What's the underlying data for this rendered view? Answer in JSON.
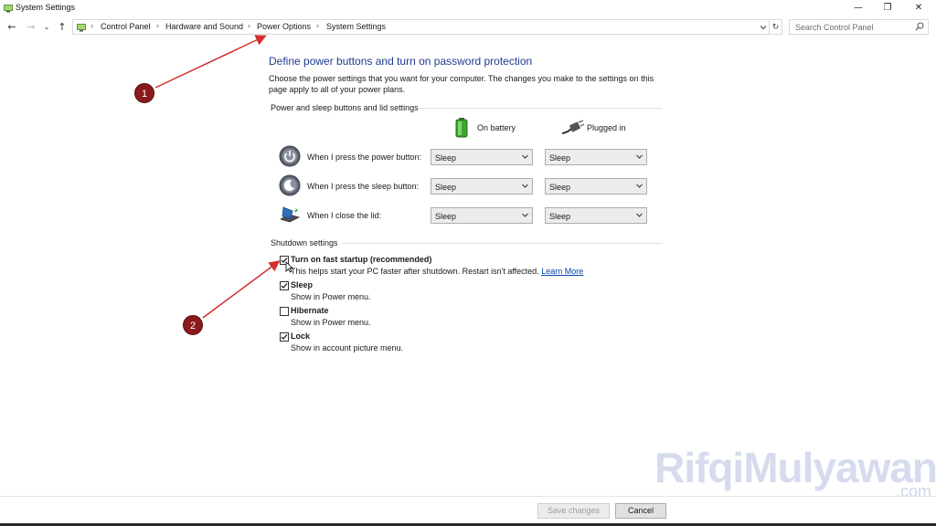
{
  "window": {
    "title": "System Settings",
    "controls": {
      "minimize": "—",
      "restore": "❐",
      "close": "✕"
    }
  },
  "navigation": {
    "back": "←",
    "forward": "→",
    "recent": "⌄",
    "up": "↑",
    "breadcrumbs": [
      "Control Panel",
      "Hardware and Sound",
      "Power Options",
      "System Settings"
    ],
    "separator": "›",
    "refresh": "↻",
    "search_placeholder": "Search Control Panel"
  },
  "main": {
    "heading": "Define power buttons and turn on password protection",
    "intro": "Choose the power settings that you want for your computer. The changes you make to the settings on this page apply to all of your power plans.",
    "power_section": {
      "title": "Power and sleep buttons and lid settings",
      "columns": {
        "battery": "On battery",
        "plugged": "Plugged in"
      },
      "rows": [
        {
          "label": "When I press the power button:",
          "battery": "Sleep",
          "plugged": "Sleep",
          "icon": "power-button-icon"
        },
        {
          "label": "When I press the sleep button:",
          "battery": "Sleep",
          "plugged": "Sleep",
          "icon": "sleep-button-icon"
        },
        {
          "label": "When I close the lid:",
          "battery": "Sleep",
          "plugged": "Sleep",
          "icon": "laptop-lid-icon"
        }
      ]
    },
    "shutdown_section": {
      "title": "Shutdown settings",
      "items": [
        {
          "label": "Turn on fast startup (recommended)",
          "desc": "This helps start your PC faster after shutdown. Restart isn't affected.",
          "link": "Learn More",
          "checked": true
        },
        {
          "label": "Sleep",
          "desc": "Show in Power menu.",
          "checked": true
        },
        {
          "label": "Hibernate",
          "desc": "Show in Power menu.",
          "checked": false
        },
        {
          "label": "Lock",
          "desc": "Show in account picture menu.",
          "checked": true
        }
      ]
    }
  },
  "footer": {
    "save": "Save changes",
    "cancel": "Cancel"
  },
  "annotations": {
    "marker_1": "1",
    "marker_2": "2",
    "color": "#d32f2f"
  },
  "watermark": {
    "text": "RifqiMulyawan",
    "suffix": ".com"
  }
}
